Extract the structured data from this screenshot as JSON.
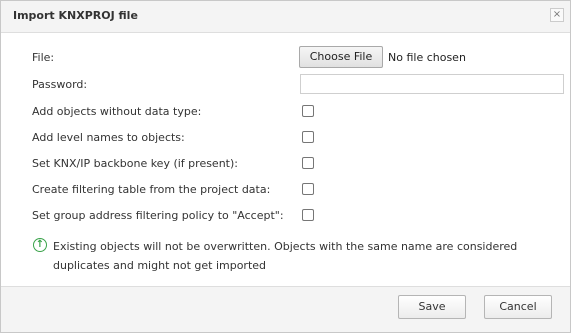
{
  "dialog": {
    "title": "Import KNXPROJ file",
    "close_glyph": "×"
  },
  "form": {
    "file_label": "File:",
    "choose_file_label": "Choose File",
    "file_status": "No file chosen",
    "password_label": "Password:",
    "password_value": "",
    "options": [
      {
        "label": "Add objects without data type:",
        "checked": false
      },
      {
        "label": "Add level names to objects:",
        "checked": false
      },
      {
        "label": "Set KNX/IP backbone key (if present):",
        "checked": false
      },
      {
        "label": "Create filtering table from the project data:",
        "checked": false
      },
      {
        "label": "Set group address filtering policy to \"Accept\":",
        "checked": false
      }
    ]
  },
  "info": {
    "icon": "info-arrow-icon",
    "text": "Existing objects will not be overwritten. Objects with the same name are considered duplicates and might not get imported"
  },
  "footer": {
    "save_label": "Save",
    "cancel_label": "Cancel"
  },
  "colors": {
    "info_icon": "#3aa34a",
    "title_bar": "#f4f4f4"
  }
}
